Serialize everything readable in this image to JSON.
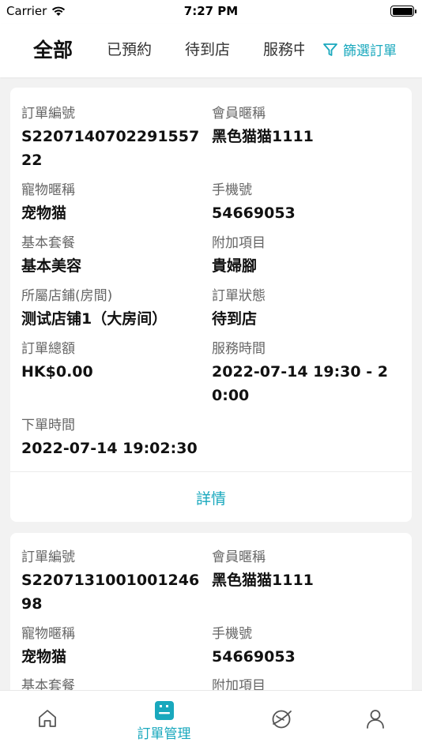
{
  "status_bar": {
    "carrier": "Carrier",
    "time": "7:27 PM"
  },
  "tabs": [
    {
      "label": "全部",
      "active": true
    },
    {
      "label": "已預約",
      "active": false
    },
    {
      "label": "待到店",
      "active": false
    },
    {
      "label": "服務中",
      "active": false
    }
  ],
  "filter": {
    "label": "篩選訂單",
    "icon": "filter-icon"
  },
  "accent_color": "#19a8bd",
  "orders": [
    {
      "order_no_label": "訂單編號",
      "order_no": "S220714070229155722",
      "member_label": "會員暱稱",
      "member": "黑色猫猫1111",
      "pet_label": "寵物暱稱",
      "pet": "宠物猫",
      "phone_label": "手機號",
      "phone": "54669053",
      "package_label": "基本套餐",
      "package": "基本美容",
      "addon_label": "附加項目",
      "addon": "貴婦腳",
      "store_label": "所屬店鋪(房間)",
      "store": "测试店铺1（大房间）",
      "status_label": "訂單狀態",
      "status": "待到店",
      "amount_label": "訂單總額",
      "amount": "HK$0.00",
      "service_time_label": "服務時間",
      "service_time": "2022-07-14 19:30 - 20:00",
      "created_label": "下單時間",
      "created": "2022-07-14 19:02:30",
      "detail_label": "詳情"
    },
    {
      "order_no_label": "訂單編號",
      "order_no": "S220713100100124698",
      "member_label": "會員暱稱",
      "member": "黑色猫猫1111",
      "pet_label": "寵物暱稱",
      "pet": "宠物猫",
      "phone_label": "手機號",
      "phone": "54669053",
      "package_label": "基本套餐",
      "addon_label": "附加項目"
    }
  ],
  "bottom_nav": [
    {
      "icon": "home-icon",
      "label": "",
      "active": false
    },
    {
      "icon": "order-management-icon",
      "label": "訂單管理",
      "active": true
    },
    {
      "icon": "planet-icon",
      "label": "",
      "active": false
    },
    {
      "icon": "user-icon",
      "label": "",
      "active": false
    }
  ]
}
